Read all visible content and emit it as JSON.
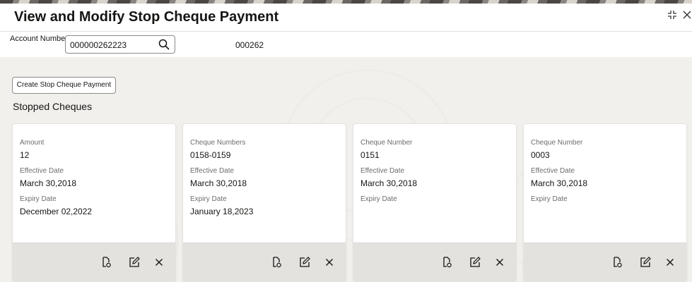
{
  "window": {
    "title": "View and Modify Stop Cheque Payment",
    "controls": [
      "minimize-icon",
      "close-icon"
    ]
  },
  "account": {
    "label": "Account Number",
    "value": "000000262223",
    "name": "000262"
  },
  "actions": {
    "create_label": "Create Stop Cheque Payment"
  },
  "section": {
    "title": "Stopped Cheques"
  },
  "cards": [
    {
      "field1_label": "Amount",
      "field1_value": "12",
      "field2_label": "Effective Date",
      "field2_value": "March 30,2018",
      "field3_label": "Expiry Date",
      "field3_value": "December 02,2022"
    },
    {
      "field1_label": "Cheque Numbers",
      "field1_value": "0158-0159",
      "field2_label": "Effective Date",
      "field2_value": "March 30,2018",
      "field3_label": "Expiry Date",
      "field3_value": "January 18,2023"
    },
    {
      "field1_label": "Cheque Number",
      "field1_value": "0151",
      "field2_label": "Effective Date",
      "field2_value": "March 30,2018",
      "field3_label": "Expiry Date",
      "field3_value": ""
    },
    {
      "field1_label": "Cheque Number",
      "field1_value": "0003",
      "field2_label": "Effective Date",
      "field2_value": "March 30,2018",
      "field3_label": "Expiry Date",
      "field3_value": ""
    }
  ],
  "card_actions": [
    "view-icon",
    "edit-icon",
    "delete-icon"
  ]
}
